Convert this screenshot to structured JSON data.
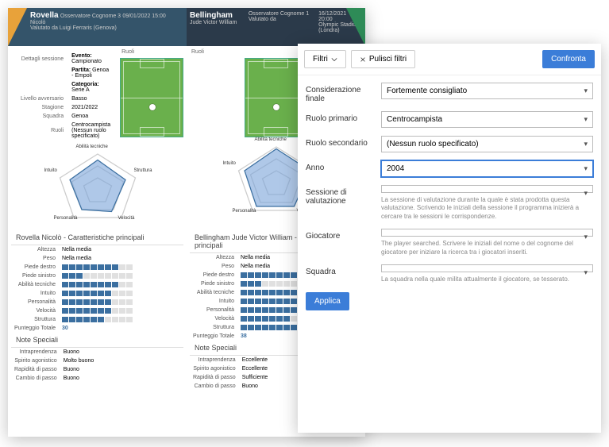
{
  "playerA": {
    "surname": "Rovella",
    "firstname": "Nicolò",
    "observer_lbl": "Osservatore Cognome 3",
    "datetime": "09/01/2022 15:00",
    "valutato_lbl": "Valutato da",
    "valutato_val": "Luigi Ferraris (Genova)"
  },
  "playerB": {
    "surname": "Bellingham",
    "firstname": "Jude Victor William",
    "observer_lbl": "Osservatore Cognome 1",
    "valutato_lbl": "Valutato da",
    "date": "16/12/2021",
    "time": "20:00",
    "venue": "Olympic Stadium",
    "city": "(Londra)"
  },
  "session": {
    "title": "Dettagli sessione",
    "rows": {
      "evento_k": "Evento:",
      "evento_v": "Campionato",
      "partita_k": "Partita:",
      "partita_v": "Genoa - Empoli",
      "categoria_k": "Categoria:",
      "categoria_v": "Serie A",
      "liv_k": "Livello avversario",
      "liv_v": "Basso",
      "stag_k": "Stagione",
      "stag_v": "2021/2022",
      "sq_k": "Squadra",
      "sq_v": "Genoa",
      "ruoli_k": "Ruoli",
      "ruoli_v1": "Centrocampista",
      "ruoli_v2": "(Nessun ruolo specificato)"
    }
  },
  "ruoli_lbl": "Ruoli",
  "radar": {
    "lbls": {
      "top": "Abilità tecniche",
      "r": "Struttura",
      "br": "Velocità",
      "bl": "Personalità",
      "l": "Intuito"
    }
  },
  "charA": {
    "title": "Rovella Nicolò - Caratteristiche principali",
    "alt_k": "Altezza",
    "alt_v": "Nella media",
    "peso_k": "Peso",
    "peso_v": "Nella media",
    "rows": [
      "Piede destro",
      "Piede sinistro",
      "Abilità tecniche",
      "Intuito",
      "Personalità",
      "Velocità",
      "Struttura"
    ],
    "fills": [
      8,
      3,
      8,
      7,
      7,
      7,
      6
    ],
    "tot_k": "Punteggio Totale",
    "tot_v": "30"
  },
  "charB": {
    "title": "Bellingham Jude Victor William - Caratteristiche principali",
    "alt_k": "Altezza",
    "alt_v": "Nella media",
    "peso_k": "Peso",
    "peso_v": "Nella media",
    "rows": [
      "Piede destro",
      "Piede sinistro",
      "Abilità tecniche",
      "Intuito",
      "Personalità",
      "Velocità",
      "Struttura"
    ],
    "fills": [
      8,
      3,
      9,
      8,
      8,
      7,
      8
    ],
    "tot_k": "Punteggio Totale",
    "tot_v": "38"
  },
  "notes": {
    "title": "Note Speciali",
    "keys": [
      "Intraprendenza",
      "Spirito agonistico",
      "Rapidità di passo",
      "Cambio di passo"
    ],
    "valsA": [
      "Buono",
      "Molto buono",
      "Buono",
      "Buono"
    ],
    "valsB": [
      "Eccellente",
      "Eccellente",
      "Sufficiente",
      "Buono"
    ]
  },
  "filters": {
    "filtri": "Filtri",
    "pulisci": "Pulisci filtri",
    "confronta": "Confronta",
    "applica": "Applica",
    "fields": {
      "cons_l": "Considerazione finale",
      "cons_v": "Fortemente consigliato",
      "rp_l": "Ruolo primario",
      "rp_v": "Centrocampista",
      "rs_l": "Ruolo secondario",
      "rs_v": "(Nessun ruolo specificato)",
      "anno_l": "Anno",
      "anno_v": "2004",
      "sess_l": "Sessione di valutazione",
      "sess_v": "",
      "sess_h": "La sessione di valutazione durante la quale è stata prodotta questa valutazione. Scrivendo le iniziali della sessione il programma inizierà a cercare tra le sessioni le corrispondenze.",
      "gioc_l": "Giocatore",
      "gioc_v": "",
      "gioc_h": "The player searched. Scrivere le iniziali del nome o del cognome del giocatore per iniziare la ricerca tra i giocatori inseriti.",
      "sq_l": "Squadra",
      "sq_v": "",
      "sq_h": "La squadra nella quale milita attualmente il giocatore, se tesserato."
    }
  },
  "chart_data": [
    {
      "type": "radar",
      "player": "Rovella",
      "axes": [
        "Abilità tecniche",
        "Struttura",
        "Velocità",
        "Personalità",
        "Intuito"
      ],
      "values": [
        8,
        6,
        7,
        7,
        7
      ],
      "range": [
        0,
        10
      ]
    },
    {
      "type": "radar",
      "player": "Bellingham",
      "axes": [
        "Abilità tecniche",
        "Struttura",
        "Velocità",
        "Personalità",
        "Intuito"
      ],
      "values": [
        9,
        8,
        7,
        8,
        8
      ],
      "range": [
        0,
        10
      ]
    },
    {
      "type": "bar",
      "player": "Rovella",
      "categories": [
        "Piede destro",
        "Piede sinistro",
        "Abilità tecniche",
        "Intuito",
        "Personalità",
        "Velocità",
        "Struttura"
      ],
      "values": [
        8,
        3,
        8,
        7,
        7,
        7,
        6
      ],
      "range": [
        0,
        10
      ]
    },
    {
      "type": "bar",
      "player": "Bellingham",
      "categories": [
        "Piede destro",
        "Piede sinistro",
        "Abilità tecniche",
        "Intuito",
        "Personalità",
        "Velocità",
        "Struttura"
      ],
      "values": [
        8,
        3,
        9,
        8,
        8,
        7,
        8
      ],
      "range": [
        0,
        10
      ]
    }
  ]
}
